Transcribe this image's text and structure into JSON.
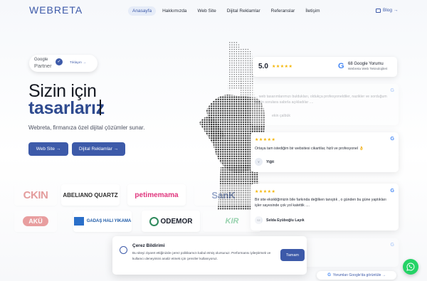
{
  "header": {
    "logo": "WEBRETA",
    "nav": [
      "Anasayfa",
      "Hakkımızda",
      "Web Site",
      "Dijital Reklamlar",
      "Referanslar",
      "İletişim"
    ],
    "active_nav": "Anasayfa",
    "blog_label": "Blog →"
  },
  "partner_badge": {
    "google_word": "Google",
    "partner_word": "Partner",
    "link_label": "Tıklayın →"
  },
  "hero": {
    "line1": "Sizin için",
    "line2": "tasarlarız",
    "subtitle": "Webreta, firmanıza özel dijital çözümler sunar.",
    "btn_web": "Web Site →",
    "btn_digital": "Dijital Reklamlar →"
  },
  "rating": {
    "score": "5.0",
    "stars": "★★★★★",
    "count": "68 Google Yorumu",
    "business": "Webreta Web Teknolojileri"
  },
  "reviews": [
    {
      "stars": "",
      "text": "... web tasarımlarımızı buldukları, oldukça profesyoneldiler, nazikler ve sorduğum bütün sorulara sabırla açıkladılar ....",
      "avatar": "",
      "name": "ekin çalbük"
    },
    {
      "stars": "★★★★★",
      "text": "Ortaya tam istediğim bir websitesi cikartilar, hizli ve profesyonel 👌",
      "avatar": "Y",
      "name": "Yiğit"
    },
    {
      "stars": "★★★★★",
      "text": "Bir site eksikliğimizin bile farkında değilken tanıştık , o günden bu güne yaptıkları işler sayesinde çok yol katettik ....",
      "avatar": "SE",
      "name": "Selda Eyüboğlu Layık"
    }
  ],
  "brands": [
    "CKIN",
    "ABELIANO QUARTZ",
    "petimemama",
    "SanK",
    "AKÜ",
    "GADAŞ HALI YIKAMA",
    "ODEMOR",
    "KIR"
  ],
  "cookie": {
    "title": "Çerez Bildirimi",
    "body": "Bu siteyi ziyaret ettiğinizde çerez politikamızı kabul etmiş olursunuz. Performansı iyileştirmek ve kullanıcı deneyimini analiz etmek için çerezler kullanıyoruz.",
    "accept": "Tamam"
  },
  "google_view_link": "Yorumları Google'da görüntüle →",
  "colors": {
    "brand": "#3d5aa9",
    "star": "#f4b400",
    "whatsapp": "#25d366"
  }
}
